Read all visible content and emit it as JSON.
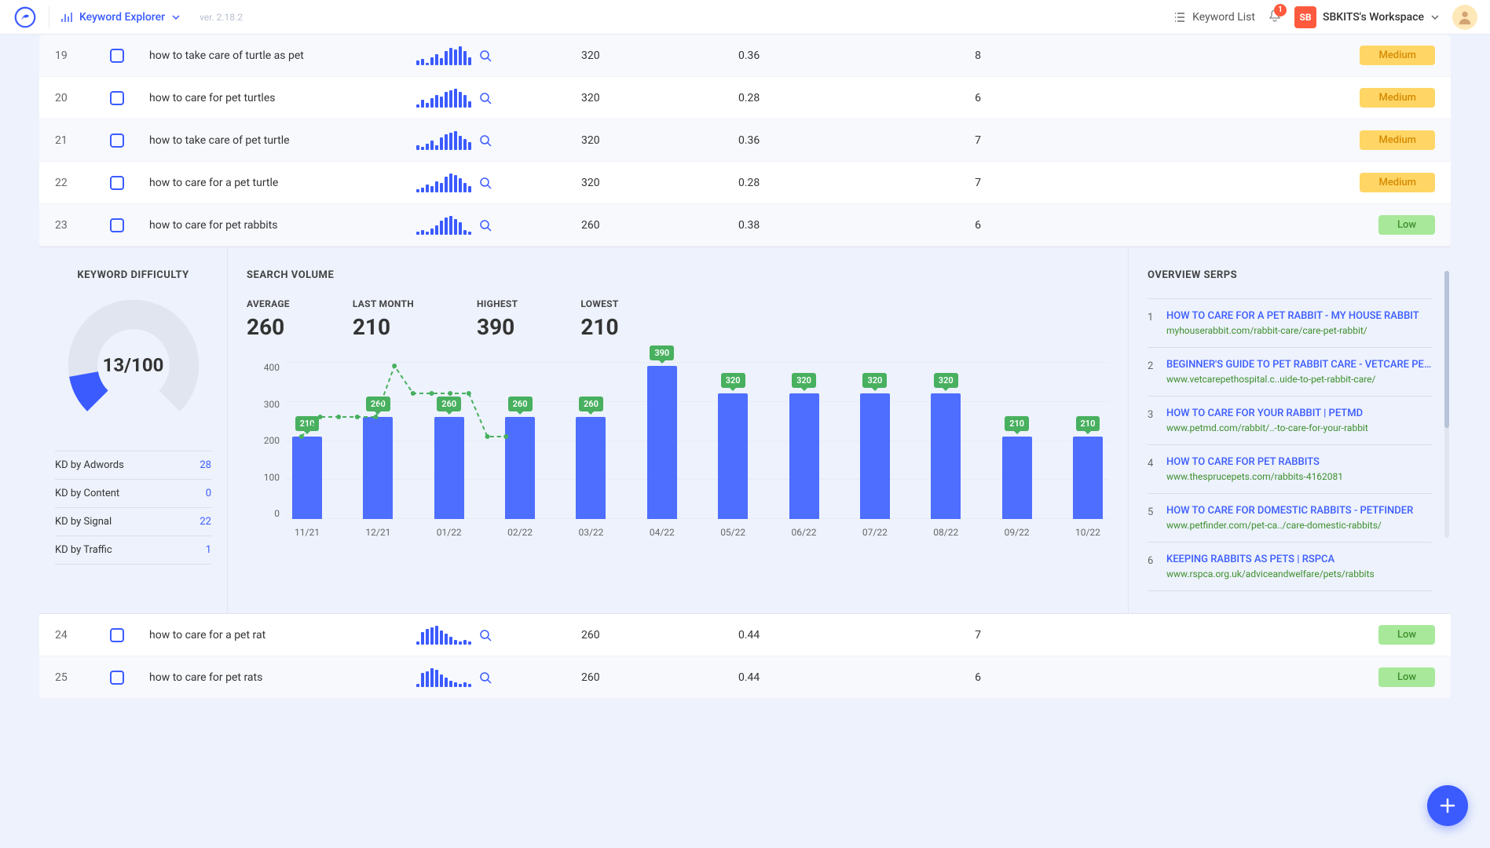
{
  "header": {
    "page_name": "Keyword Explorer",
    "version": "ver. 2.18.2",
    "kw_list": "Keyword List",
    "notifications": "1",
    "workspace_short": "SB",
    "workspace": "SBKITS's Workspace"
  },
  "rows_top": [
    {
      "idx": "19",
      "kw": "how to take care of turtle as pet",
      "vol": "320",
      "v2": "0.36",
      "v3": "8",
      "diff": "Medium",
      "diff_cls": "diff-medium",
      "spark": [
        6,
        8,
        3,
        10,
        14,
        9,
        18,
        22,
        20,
        24,
        18,
        10
      ]
    },
    {
      "idx": "20",
      "kw": "how to care for pet turtles",
      "vol": "320",
      "v2": "0.28",
      "v3": "6",
      "diff": "Medium",
      "diff_cls": "diff-medium",
      "spark": [
        4,
        10,
        6,
        12,
        16,
        14,
        20,
        22,
        24,
        20,
        16,
        8
      ]
    },
    {
      "idx": "21",
      "kw": "how to take care of pet turtle",
      "vol": "320",
      "v2": "0.36",
      "v3": "7",
      "diff": "Medium",
      "diff_cls": "diff-medium",
      "spark": [
        6,
        4,
        8,
        12,
        6,
        16,
        20,
        22,
        24,
        18,
        14,
        10
      ]
    },
    {
      "idx": "22",
      "kw": "how to care for a pet turtle",
      "vol": "320",
      "v2": "0.28",
      "v3": "7",
      "diff": "Medium",
      "diff_cls": "diff-medium",
      "spark": [
        4,
        6,
        10,
        8,
        14,
        12,
        20,
        24,
        22,
        18,
        12,
        8
      ]
    },
    {
      "idx": "23",
      "kw": "how to care for pet rabbits",
      "vol": "260",
      "v2": "0.38",
      "v3": "6",
      "diff": "Low",
      "diff_cls": "diff-low",
      "spark": [
        4,
        6,
        4,
        8,
        12,
        18,
        22,
        24,
        20,
        16,
        6,
        4
      ]
    }
  ],
  "rows_bottom": [
    {
      "idx": "24",
      "kw": "how to care for a pet rat",
      "vol": "260",
      "v2": "0.44",
      "v3": "7",
      "diff": "Low",
      "diff_cls": "diff-low",
      "spark": [
        4,
        16,
        20,
        22,
        24,
        18,
        14,
        10,
        6,
        4,
        6,
        4
      ]
    },
    {
      "idx": "25",
      "kw": "how to care for pet rats",
      "vol": "260",
      "v2": "0.44",
      "v3": "6",
      "diff": "Low",
      "diff_cls": "diff-low",
      "spark": [
        4,
        18,
        20,
        24,
        22,
        16,
        12,
        8,
        6,
        4,
        6,
        4
      ]
    }
  ],
  "kd": {
    "title": "KEYWORD DIFFICULTY",
    "score": "13/100",
    "rows": [
      {
        "label": "KD by Adwords",
        "v": "28"
      },
      {
        "label": "KD by Content",
        "v": "0"
      },
      {
        "label": "KD by Signal",
        "v": "22"
      },
      {
        "label": "KD by Traffic",
        "v": "1"
      }
    ]
  },
  "sv": {
    "title": "SEARCH VOLUME",
    "stats": {
      "avg_l": "AVERAGE",
      "avg_v": "260",
      "last_l": "LAST MONTH",
      "last_v": "210",
      "high_l": "HIGHEST",
      "high_v": "390",
      "low_l": "LOWEST",
      "low_v": "210"
    },
    "yticks": [
      "400",
      "300",
      "200",
      "100",
      "0"
    ]
  },
  "chart_data": {
    "type": "bar",
    "categories": [
      "11/21",
      "12/21",
      "01/22",
      "02/22",
      "03/22",
      "04/22",
      "05/22",
      "06/22",
      "07/22",
      "08/22",
      "09/22",
      "10/22"
    ],
    "values": [
      210,
      260,
      260,
      260,
      260,
      390,
      320,
      320,
      320,
      320,
      210,
      210
    ],
    "ylabel": "",
    "ylim": [
      0,
      400
    ]
  },
  "serps": {
    "title": "OVERVIEW SERPS",
    "items": [
      {
        "idx": "1",
        "title": "HOW TO CARE FOR A PET RABBIT - MY HOUSE RABBIT",
        "url": "myhouserabbit.com/rabbit-care/care-pet-rabbit/"
      },
      {
        "idx": "2",
        "title": "BEGINNER'S GUIDE TO PET RABBIT CARE - VETCARE PET HOS...",
        "url": "www.vetcarepethospital.c..uide-to-pet-rabbit-care/"
      },
      {
        "idx": "3",
        "title": "HOW TO CARE FOR YOUR RABBIT | PETMD",
        "url": "www.petmd.com/rabbit/..-to-care-for-your-rabbit"
      },
      {
        "idx": "4",
        "title": "HOW TO CARE FOR PET RABBITS",
        "url": "www.thesprucepets.com/rabbits-4162081"
      },
      {
        "idx": "5",
        "title": "HOW TO CARE FOR DOMESTIC RABBITS - PETFINDER",
        "url": "www.petfinder.com/pet-ca../care-domestic-rabbits/"
      },
      {
        "idx": "6",
        "title": "KEEPING RABBITS AS PETS | RSPCA",
        "url": "www.rspca.org.uk/adviceandwelfare/pets/rabbits"
      }
    ]
  }
}
